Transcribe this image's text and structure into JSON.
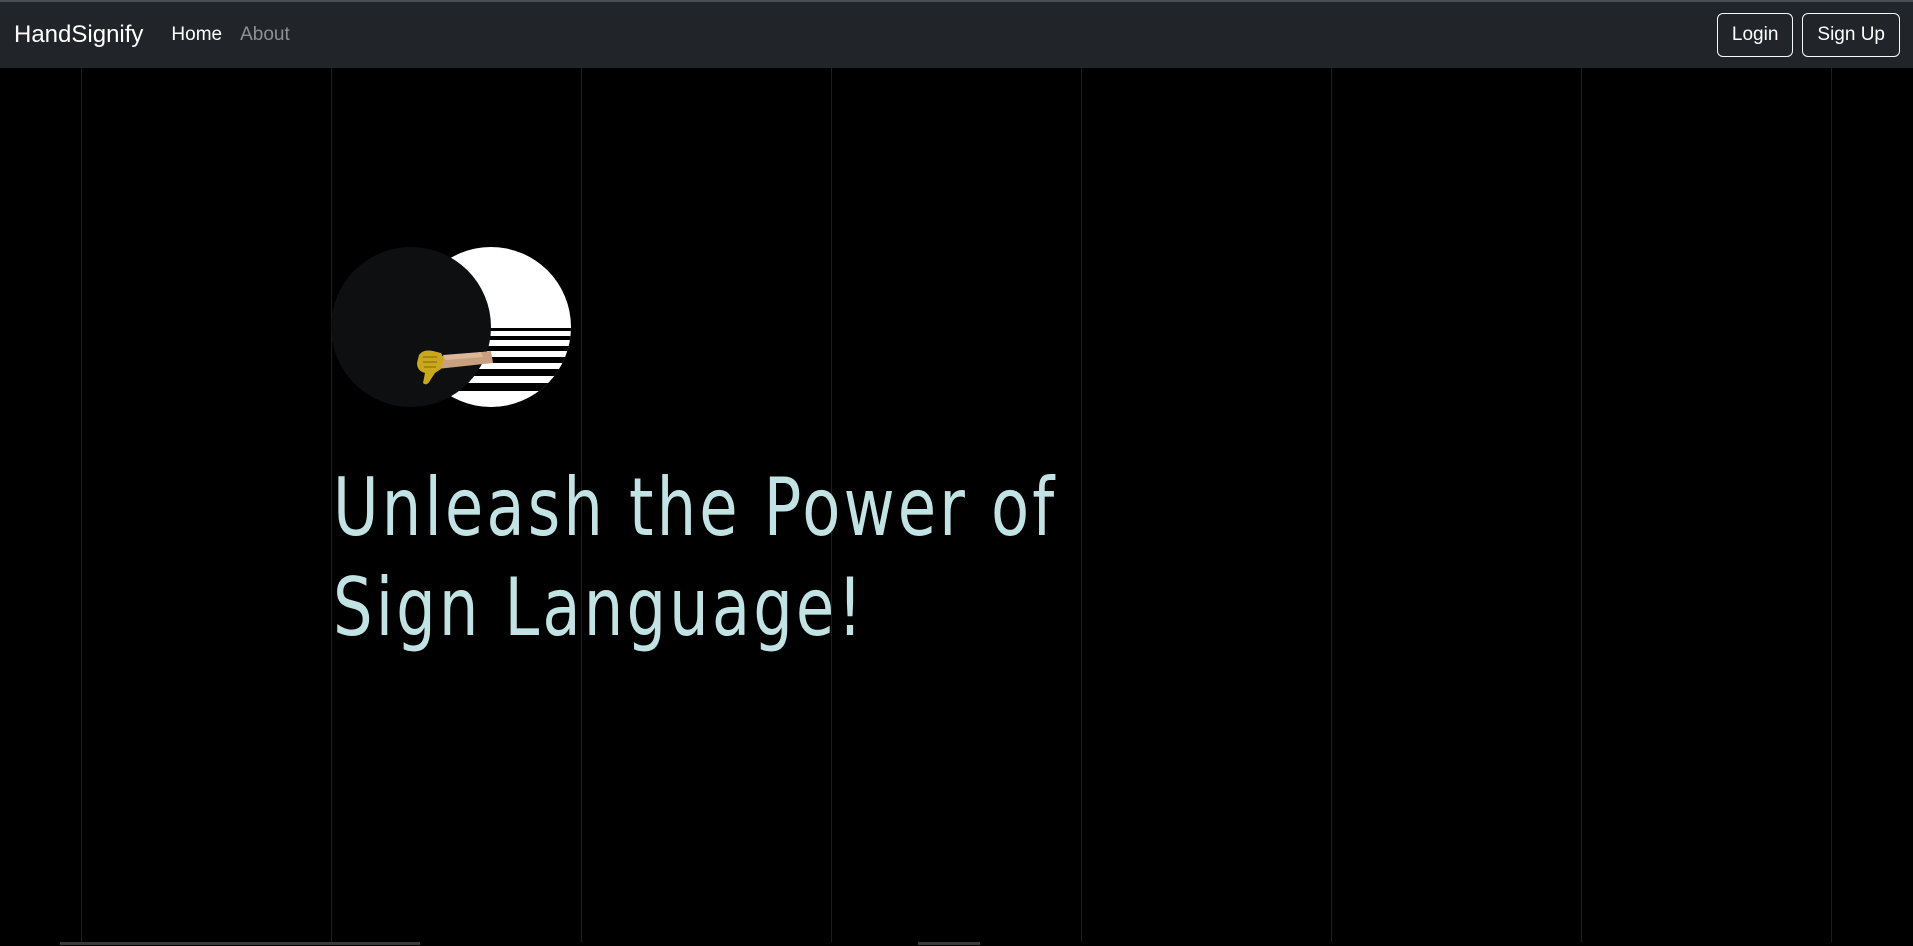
{
  "navbar": {
    "brand": "HandSignify",
    "links": [
      {
        "label": "Home",
        "active": true
      },
      {
        "label": "About",
        "active": false
      }
    ],
    "login_label": "Login",
    "signup_label": "Sign Up"
  },
  "hero": {
    "headline_line1": "Unleash the Power of",
    "headline_line2": "Sign Language!",
    "logo_icon": "hand-thumbs-down-circle-logo"
  },
  "colors": {
    "navbar_bg": "#212529",
    "page_bg": "#000000",
    "headline": "#c2e3e3",
    "hand_yellow": "#c9a81c"
  }
}
